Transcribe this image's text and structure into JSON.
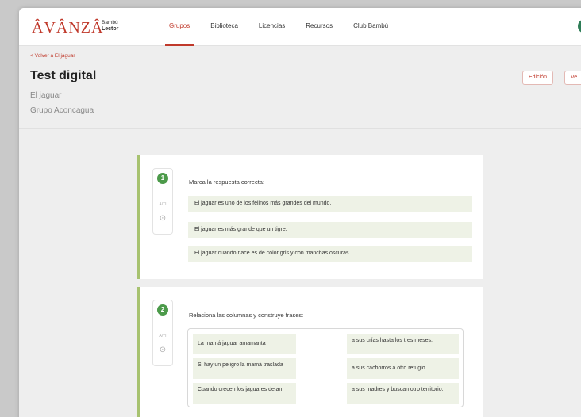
{
  "brand": {
    "name": "ÂVÂNZÂ",
    "line1": "Bambú",
    "line2": "Lector",
    "color": "#c0392b"
  },
  "nav": {
    "items": [
      {
        "label": "Grupos",
        "active": true
      },
      {
        "label": "Biblioteca"
      },
      {
        "label": "Licencias"
      },
      {
        "label": "Recursos"
      },
      {
        "label": "Club Bambú"
      }
    ]
  },
  "header": {
    "back": "< Volver a El jaguar",
    "title": "Test digital",
    "book": "El jaguar",
    "group": "Grupo Aconcagua",
    "edit_button": "Edición",
    "view_button": "Ve"
  },
  "questions": [
    {
      "number": "1",
      "meta": "A/TI",
      "prompt": "Marca la respuesta correcta:",
      "options": [
        "El jaguar es uno de los felinos más grandes del mundo.",
        "El jaguar es más grande que un tigre.",
        "El jaguar cuando nace es de color gris y con manchas oscuras."
      ]
    },
    {
      "number": "2",
      "meta": "A/TI",
      "prompt": "Relaciona las columnas y construye frases:",
      "left": [
        "La mamá jaguar amamanta",
        "Si hay un peligro la mamá traslada",
        "Cuando crecen los jaguares dejan"
      ],
      "right": [
        "a sus crías hasta los tres meses.",
        "a sus cachorros a otro refugio.",
        "a sus madres y buscan otro territorio."
      ]
    }
  ],
  "colors": {
    "accent": "#c0392b",
    "green": "#4c9a4a",
    "option_bg": "#eef2e6"
  }
}
